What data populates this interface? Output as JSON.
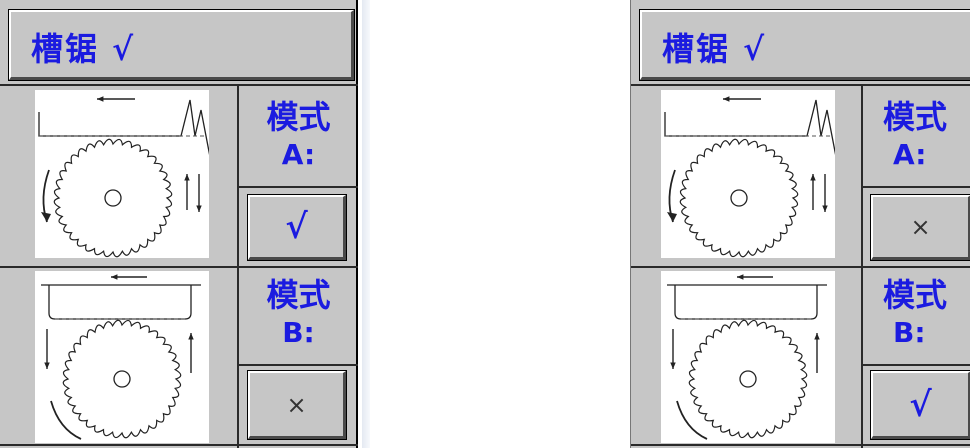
{
  "panels": [
    {
      "title": "槽锯  √",
      "mode_a": {
        "label": "模式",
        "letter": "A:",
        "status": "√",
        "active": true
      },
      "mode_b": {
        "label": "模式",
        "letter": "B:",
        "status": "×",
        "active": false
      }
    },
    {
      "title": "槽锯  √",
      "mode_a": {
        "label": "模式",
        "letter": "A:",
        "status": "×",
        "active": false
      },
      "mode_b": {
        "label": "模式",
        "letter": "B:",
        "status": "√",
        "active": true
      }
    }
  ],
  "colors": {
    "panel_bg": "#c6c6c6",
    "accent_text": "#1b1be0",
    "diagram_bg": "#ffffff"
  }
}
